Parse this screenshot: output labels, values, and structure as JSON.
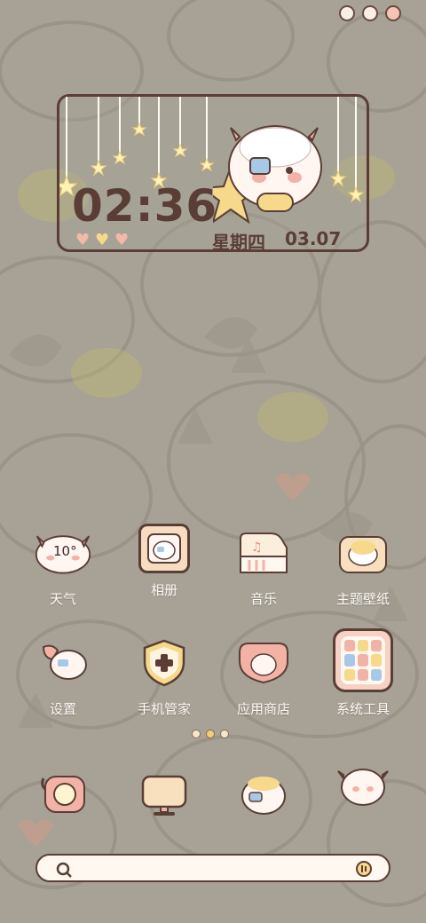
{
  "clock": {
    "time": "02:36",
    "weekday": "星期四",
    "date": "03.07"
  },
  "apps": [
    {
      "label": "天气",
      "icon": "sheep-weather-icon",
      "badge": "10°"
    },
    {
      "label": "相册",
      "icon": "photo-frame-icon"
    },
    {
      "label": "音乐",
      "icon": "music-card-icon"
    },
    {
      "label": "主题壁纸",
      "icon": "theme-wallpaper-icon"
    },
    {
      "label": "设置",
      "icon": "settings-sheep-icon"
    },
    {
      "label": "手机管家",
      "icon": "phone-manager-shield-icon"
    },
    {
      "label": "应用商店",
      "icon": "app-store-sheep-icon"
    },
    {
      "label": "系统工具",
      "icon": "system-tools-folder-icon"
    }
  ],
  "dock": [
    {
      "icon": "phone-dialer-icon"
    },
    {
      "icon": "screen-monitor-icon"
    },
    {
      "icon": "sheep-camera-icon"
    },
    {
      "icon": "sheep-browser-icon"
    }
  ],
  "colors": {
    "background": "#a7a196",
    "outline": "#5a3e36",
    "cream": "#fff8f0",
    "pink": "#f2b3a6",
    "yellow": "#f6d98a"
  }
}
